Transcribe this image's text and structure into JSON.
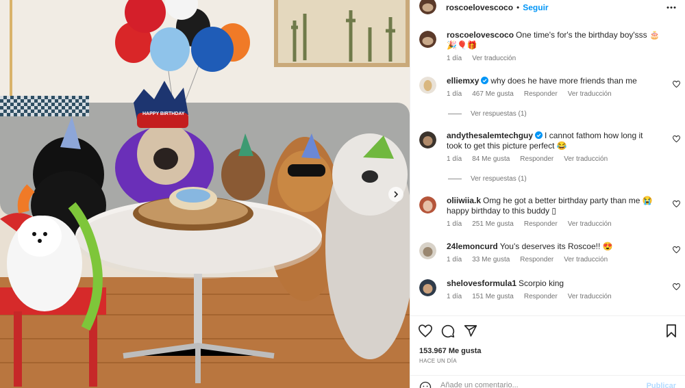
{
  "post": {
    "author": "roscoelovescoco",
    "follow_label": "Seguir",
    "separator": "•",
    "caption_text": "One time's for's the birthday boy'sss 🎂🎉🎈🎁",
    "caption_time": "1 día",
    "caption_translate": "Ver traducción",
    "likes": "153.967 Me gusta",
    "posted_ago": "HACE UN DÍA",
    "photo_banner": "HAPPY BIRTHDAY"
  },
  "comments": [
    {
      "user": "elliemxy",
      "verified": true,
      "text": "why does he have more friends than me",
      "time": "1 día",
      "likes": "467 Me gusta",
      "reply": "Responder",
      "translate": "Ver traducción",
      "replies": "Ver respuestas (1)"
    },
    {
      "user": "andythesalemtechguy",
      "verified": true,
      "text": "I cannot fathom how long it took to get this picture perfect 😂",
      "time": "1 día",
      "likes": "84 Me gusta",
      "reply": "Responder",
      "translate": "Ver traducción",
      "replies": "Ver respuestas (1)"
    },
    {
      "user": "oliiwiia.k",
      "verified": false,
      "text": "Omg he got a better birthday party than me 😭 happy birthday to this buddy ▯",
      "time": "1 día",
      "likes": "251 Me gusta",
      "reply": "Responder",
      "translate": "Ver traducción"
    },
    {
      "user": "24lemoncurd",
      "verified": false,
      "text": "You's deserves its Roscoe!! 😍",
      "time": "1 día",
      "likes": "33 Me gusta",
      "reply": "Responder",
      "translate": "Ver traducción"
    },
    {
      "user": "shelovesformula1",
      "verified": false,
      "text": "Scorpio king",
      "time": "1 día",
      "likes": "151 Me gusta",
      "reply": "Responder",
      "translate": "Ver traducción"
    }
  ],
  "composer": {
    "placeholder": "Añade un comentario...",
    "publish_label": "Publicar"
  },
  "icons": {
    "like": "heart-icon",
    "comment": "comment-icon",
    "share": "paper-plane-icon",
    "save": "bookmark-icon",
    "more": "more-options-icon",
    "emoji": "emoji-icon",
    "next": "chevron-right-icon",
    "verified": "verified-badge-icon"
  },
  "colors": {
    "accent": "#0095f6",
    "publish_disabled": "#b3dbff",
    "text": "#262626",
    "secondary": "#737373",
    "divider": "#efefef"
  }
}
